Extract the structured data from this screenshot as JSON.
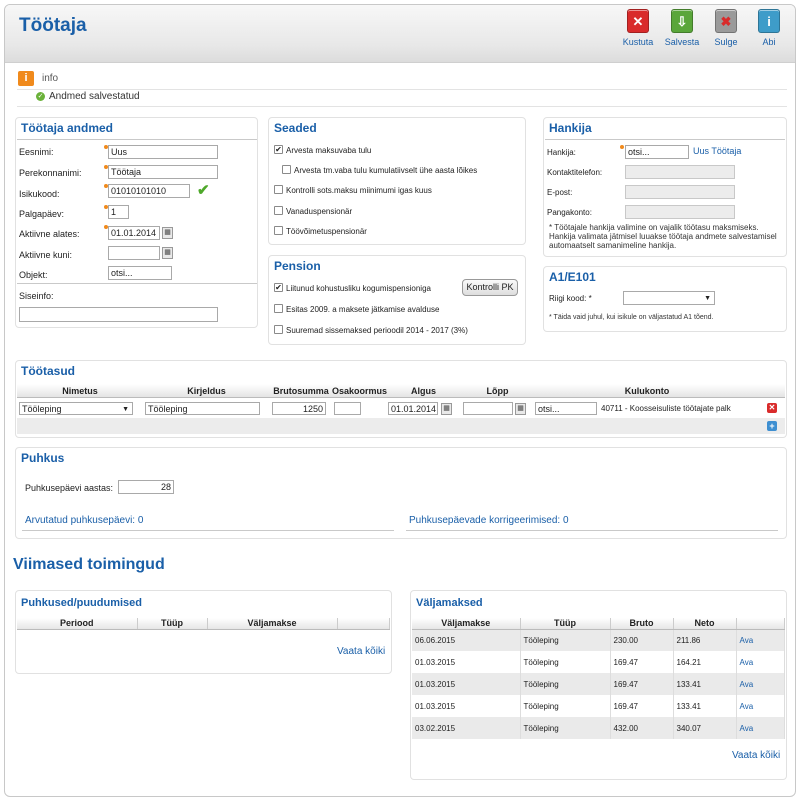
{
  "header": {
    "title": "Töötaja",
    "buttons": [
      {
        "label": "Kustuta",
        "icon": "delete-icon",
        "color": "#d92b2b"
      },
      {
        "label": "Salvesta",
        "icon": "save-icon",
        "color": "#5aa63a"
      },
      {
        "label": "Sulge",
        "icon": "close-icon",
        "color": "#9a9a9a"
      },
      {
        "label": "Abi",
        "icon": "help-icon",
        "color": "#3e9cc9"
      }
    ]
  },
  "info": {
    "label": "info",
    "message": "Andmed salvestatud"
  },
  "worker": {
    "title": "Töötaja andmed",
    "first_name_label": "Eesnimi:",
    "first_name": "Uus",
    "last_name_label": "Perekonnanimi:",
    "last_name": "Töötaja",
    "id_code_label": "Isikukood:",
    "id_code": "01010101010",
    "pay_day_label": "Palgapäev:",
    "pay_day": "1",
    "active_from_label": "Aktiivne alates:",
    "active_from": "01.01.2014",
    "active_to_label": "Aktiivne kuni:",
    "active_to": "",
    "object_label": "Objekt:",
    "object_value": "otsi...",
    "internal_label": "Siseinfo:",
    "internal_value": ""
  },
  "settings": {
    "title": "Seaded",
    "items": [
      {
        "label": "Arvesta maksuvaba tulu",
        "checked": true
      },
      {
        "label": "Arvesta tm.vaba tulu kumulatiivselt ühe aasta lõikes",
        "checked": false
      },
      {
        "label": "Kontrolli sots.maksu miinimumi igas kuus",
        "checked": false
      },
      {
        "label": "Vanaduspensionär",
        "checked": false
      },
      {
        "label": "Töövõimetuspensionär",
        "checked": false
      }
    ]
  },
  "pension": {
    "title": "Pension",
    "items": [
      {
        "label": "Liitunud kohustusliku kogumispensioniga",
        "checked": true
      },
      {
        "label": "Esitas 2009. a maksete jätkamise avalduse",
        "checked": false
      },
      {
        "label": "Suuremad sissemaksed perioodil 2014 - 2017 (3%)",
        "checked": false
      }
    ],
    "button": "Kontrolli PK"
  },
  "supplier": {
    "title": "Hankija",
    "supplier_label": "Hankija:",
    "supplier_value": "otsi...",
    "new_worker_link": "Uus Töötaja",
    "phone_label": "Kontaktitelefon:",
    "email_label": "E-post:",
    "account_label": "Pangakonto:",
    "note": "* Töötajale hankija valimine on vajalik töötasu maksmiseks. Hankija valimata jätmisel luuakse töötaja andmete salvestamisel automaatselt samanimeline hankija."
  },
  "a1": {
    "title": "A1/E101",
    "country_label": "Riigi kood: *",
    "country_value": "",
    "note": "* Täida vaid juhul, kui isikule on väljastatud A1 tõend."
  },
  "wages": {
    "title": "Töötasud",
    "columns": [
      "Nimetus",
      "Kirjeldus",
      "Brutosumma",
      "Osakoormus",
      "Algus",
      "Lõpp",
      "Kulukonto"
    ],
    "row": {
      "type": "Tööleping",
      "description": "Tööleping",
      "gross": "1250",
      "share": "",
      "start": "01.01.2014",
      "end": "",
      "account_search": "otsi...",
      "account": "40711 - Koosseisuliste töötajate palk"
    }
  },
  "vacation": {
    "title": "Puhkus",
    "days_label": "Puhkusepäevi aastas:",
    "days_value": "28",
    "calculated": "Arvutatud puhkusepäevi: 0",
    "corrections": "Puhkusepäevade korrigeerimised: 0"
  },
  "recent": {
    "title": "Viimased toimingud"
  },
  "absences": {
    "title": "Puhkused/puudumised",
    "columns": [
      "Periood",
      "Tüüp",
      "Väljamakse"
    ],
    "view_all": "Vaata kõiki"
  },
  "payments": {
    "title": "Väljamaksed",
    "columns": [
      "Väljamakse",
      "Tüüp",
      "Bruto",
      "Neto",
      ""
    ],
    "rows": [
      {
        "date": "06.06.2015",
        "type": "Tööleping",
        "bruto": "230.00",
        "neto": "211.86",
        "link": "Ava"
      },
      {
        "date": "01.03.2015",
        "type": "Tööleping",
        "bruto": "169.47",
        "neto": "164.21",
        "link": "Ava"
      },
      {
        "date": "01.03.2015",
        "type": "Tööleping",
        "bruto": "169.47",
        "neto": "133.41",
        "link": "Ava"
      },
      {
        "date": "01.03.2015",
        "type": "Tööleping",
        "bruto": "169.47",
        "neto": "133.41",
        "link": "Ava"
      },
      {
        "date": "03.02.2015",
        "type": "Tööleping",
        "bruto": "432.00",
        "neto": "340.07",
        "link": "Ava"
      }
    ],
    "view_all": "Vaata kõiki"
  }
}
